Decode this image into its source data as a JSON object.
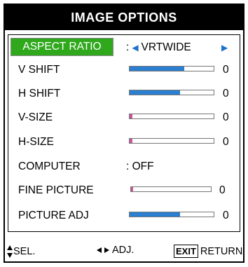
{
  "menu": {
    "title": "IMAGE OPTIONS",
    "items": [
      {
        "label": "ASPECT RATIO",
        "value": "VRTWIDE",
        "selected": true
      },
      {
        "label": "V SHIFT",
        "bar_fraction": 0.65,
        "value": "0"
      },
      {
        "label": "H SHIFT",
        "bar_fraction": 0.6,
        "value": "0"
      },
      {
        "label": "V-SIZE",
        "bar_fraction": 0.03,
        "value": "0"
      },
      {
        "label": "H-SIZE",
        "bar_fraction": 0.03,
        "value": "0"
      },
      {
        "label": "COMPUTER",
        "value": "OFF"
      },
      {
        "label": "FINE PICTURE",
        "bar_fraction": 0.03,
        "value": "0"
      },
      {
        "label": "PICTURE ADJ",
        "bar_fraction": 0.6,
        "value": "0"
      }
    ]
  },
  "footer": {
    "select_label": "SEL.",
    "adjust_label": "ADJ.",
    "exit_key": "EXIT",
    "return_label": "RETURN"
  },
  "colors": {
    "selected_bg": "#2fa81c",
    "bar_fill": "#2b7fd1",
    "bar_low": "#c8559a",
    "arrow": "#1a72c9"
  }
}
